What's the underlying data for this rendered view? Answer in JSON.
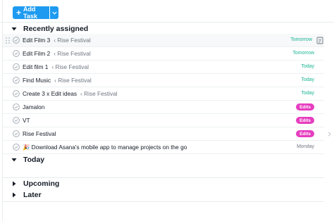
{
  "toolbar": {
    "add_task_label": "Add Task"
  },
  "sections": {
    "recently_assigned": "Recently assigned",
    "today": "Today",
    "upcoming": "Upcoming",
    "later": "Later"
  },
  "tasks": [
    {
      "name": "Edit Film 3",
      "project": "Rise Festival",
      "due": "Tomorrow"
    },
    {
      "name": "Edit Film 2",
      "project": "Rise Festival",
      "due": "Tomorrow"
    },
    {
      "name": "Edit film 1",
      "project": "Rise Festival",
      "due": "Today"
    },
    {
      "name": "Find Music",
      "project": "Rise Festival",
      "due": "Today"
    },
    {
      "name": "Create 3 x Edit ideas",
      "project": "Rise Festival",
      "due": "Today"
    },
    {
      "name": "Jamalon",
      "tag": "Edits"
    },
    {
      "name": "VT",
      "tag": "Edits"
    },
    {
      "name": "Rise Festival",
      "tag": "Edits"
    },
    {
      "name": "🎉 Download Asana's mobile app to manage projects on the go",
      "due": "Monday"
    }
  ],
  "colors": {
    "accent": "#1e9bf0",
    "due_soon": "#1ab394",
    "tag_edits": "#e63dbf"
  },
  "icons": [
    "plus-icon",
    "chevron-down-icon",
    "triangle-down-icon",
    "triangle-right-icon",
    "check-circle-icon",
    "drag-handle-icon",
    "task-detail-icon",
    "chevron-right-icon"
  ]
}
